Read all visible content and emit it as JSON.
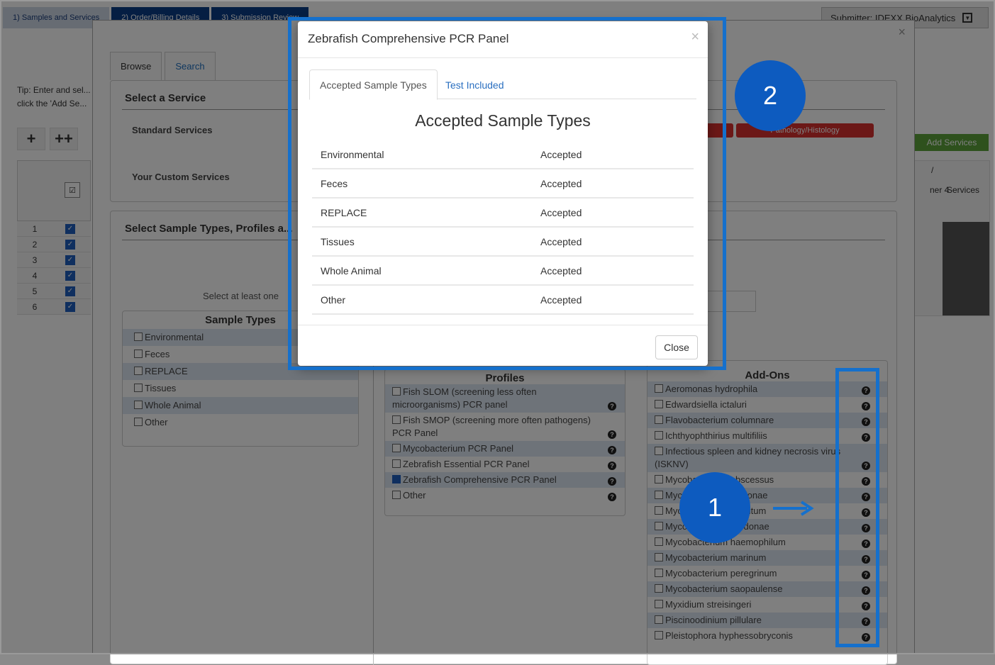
{
  "wizard": {
    "steps": [
      "1) Samples and Services",
      "2) Order/Billing Details",
      "3) Submission Review"
    ]
  },
  "submitter": {
    "label": "Submitter: IDEXX BioAnalytics"
  },
  "tip": {
    "text": "Tip: Enter and sel... click the 'Add Se..."
  },
  "grid": {
    "add_one": "+",
    "add_many": "++",
    "rows": [
      "1",
      "2",
      "3",
      "4",
      "5",
      "6"
    ],
    "right_header": [
      "ner 4",
      "Services",
      "/"
    ]
  },
  "add_services_button": "Add Services",
  "dialog": {
    "tabs": {
      "browse": "Browse",
      "search": "Search"
    },
    "select_service": {
      "title": "Select a Service",
      "standard_label": "Standard Services",
      "custom_label": "Your Custom Services",
      "pathology_button": "Pathology/Histology"
    },
    "select_sample": {
      "title": "Select Sample Types, Profiles a...",
      "hint": "Select at least one"
    },
    "sample_types": {
      "title": "Sample Types",
      "items": [
        "Environmental",
        "Feces",
        "REPLACE",
        "Tissues",
        "Whole Animal",
        "Other"
      ]
    },
    "profiles": {
      "title": "Profiles",
      "items": [
        {
          "label": "Fish SLOM (screening less often microorganisms) PCR panel",
          "checked": false
        },
        {
          "label": "Fish SMOP (screening more often pathogens) PCR Panel",
          "checked": false
        },
        {
          "label": "Mycobacterium PCR Panel",
          "checked": false
        },
        {
          "label": "Zebrafish Essential PCR Panel",
          "checked": false
        },
        {
          "label": "Zebrafish Comprehensive PCR Panel",
          "checked": true
        },
        {
          "label": "Other",
          "checked": false
        }
      ]
    },
    "addons": {
      "title": "Add-Ons",
      "items": [
        "Aeromonas hydrophila",
        "Edwardsiella ictaluri",
        "Flavobacterium columnare",
        "Ichthyophthirius multifiliis",
        "Infectious spleen and kidney necrosis virus (ISKNV)",
        "Mycobacterium abscessus",
        "Mycobacterium chelonae",
        "Mycobacterium fortuitum",
        "Mycobacterium gordonae",
        "Mycobacterium haemophilum",
        "Mycobacterium marinum",
        "Mycobacterium peregrinum",
        "Mycobacterium saopaulense",
        "Myxidium streisingeri",
        "Piscinoodinium pillulare",
        "Pleistophora hyphessobryconis"
      ]
    }
  },
  "modal": {
    "title": "Zebrafish Comprehensive PCR Panel",
    "close_x": "×",
    "tabs": {
      "active": "Accepted Sample Types",
      "other": "Test Included"
    },
    "heading": "Accepted Sample Types",
    "rows": [
      {
        "type": "Environmental",
        "status": "Accepted"
      },
      {
        "type": "Feces",
        "status": "Accepted"
      },
      {
        "type": "REPLACE",
        "status": "Accepted"
      },
      {
        "type": "Tissues",
        "status": "Accepted"
      },
      {
        "type": "Whole Animal",
        "status": "Accepted"
      },
      {
        "type": "Other",
        "status": "Accepted"
      }
    ],
    "close_button": "Close"
  },
  "annotations": {
    "badge_1": "1",
    "badge_2": "2",
    "accent_color": "#1570cc"
  }
}
